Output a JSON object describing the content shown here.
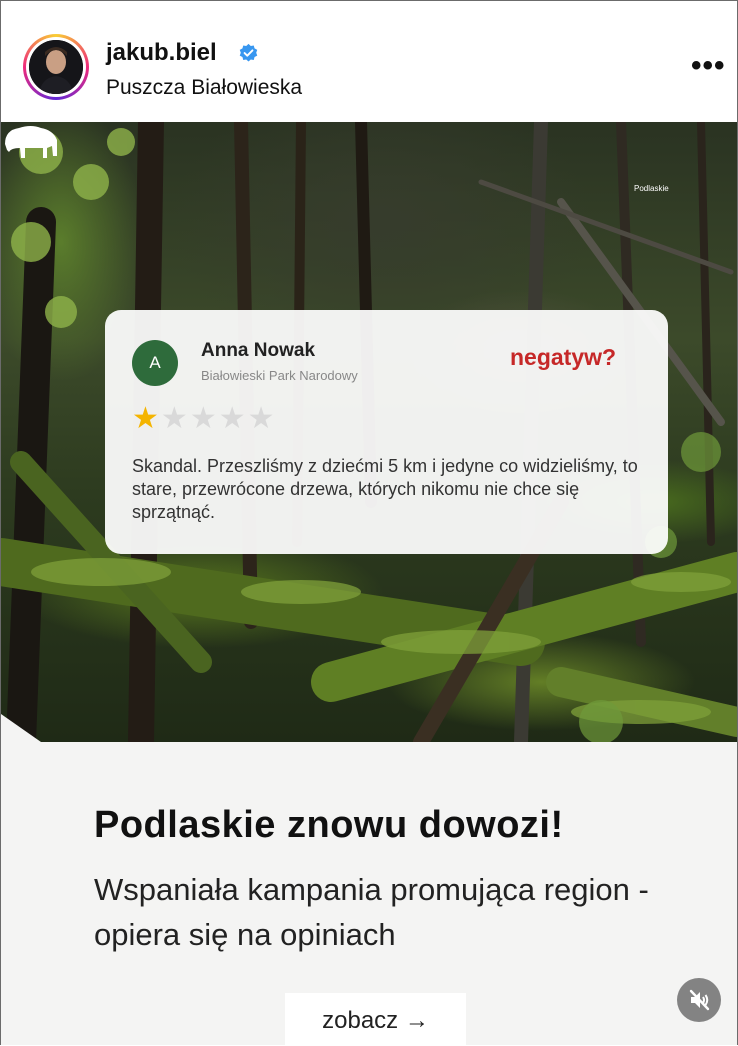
{
  "post": {
    "username": "jakub.biel",
    "location": "Puszcza Białowieska",
    "more_icon": "more-dots-icon",
    "verified_icon": "verified-badge-icon"
  },
  "media": {
    "brand_label": "Podlaskie",
    "review": {
      "avatar_letter": "A",
      "reviewer_name": "Anna Nowak",
      "place": "Białowieski Park Narodowy",
      "tag": "negatyw?",
      "rating": 1,
      "max_rating": 5,
      "text": "Skandal. Przeszliśmy z dziećmi 5 km i jedyne co widzieliśmy, to stare, przewrócone drzewa, których nikomu nie chce się sprzątnąć.",
      "colors": {
        "avatar": "#2e6b3b",
        "tag": "#c62828",
        "star": "#f4b400"
      }
    },
    "headline": "Podlaskie znowu dowozi!",
    "subtitle": "Wspaniała kampania promująca region - opiera się na opiniach",
    "cta_label": "zobacz →",
    "mute_icon": "muted-speaker-icon"
  }
}
